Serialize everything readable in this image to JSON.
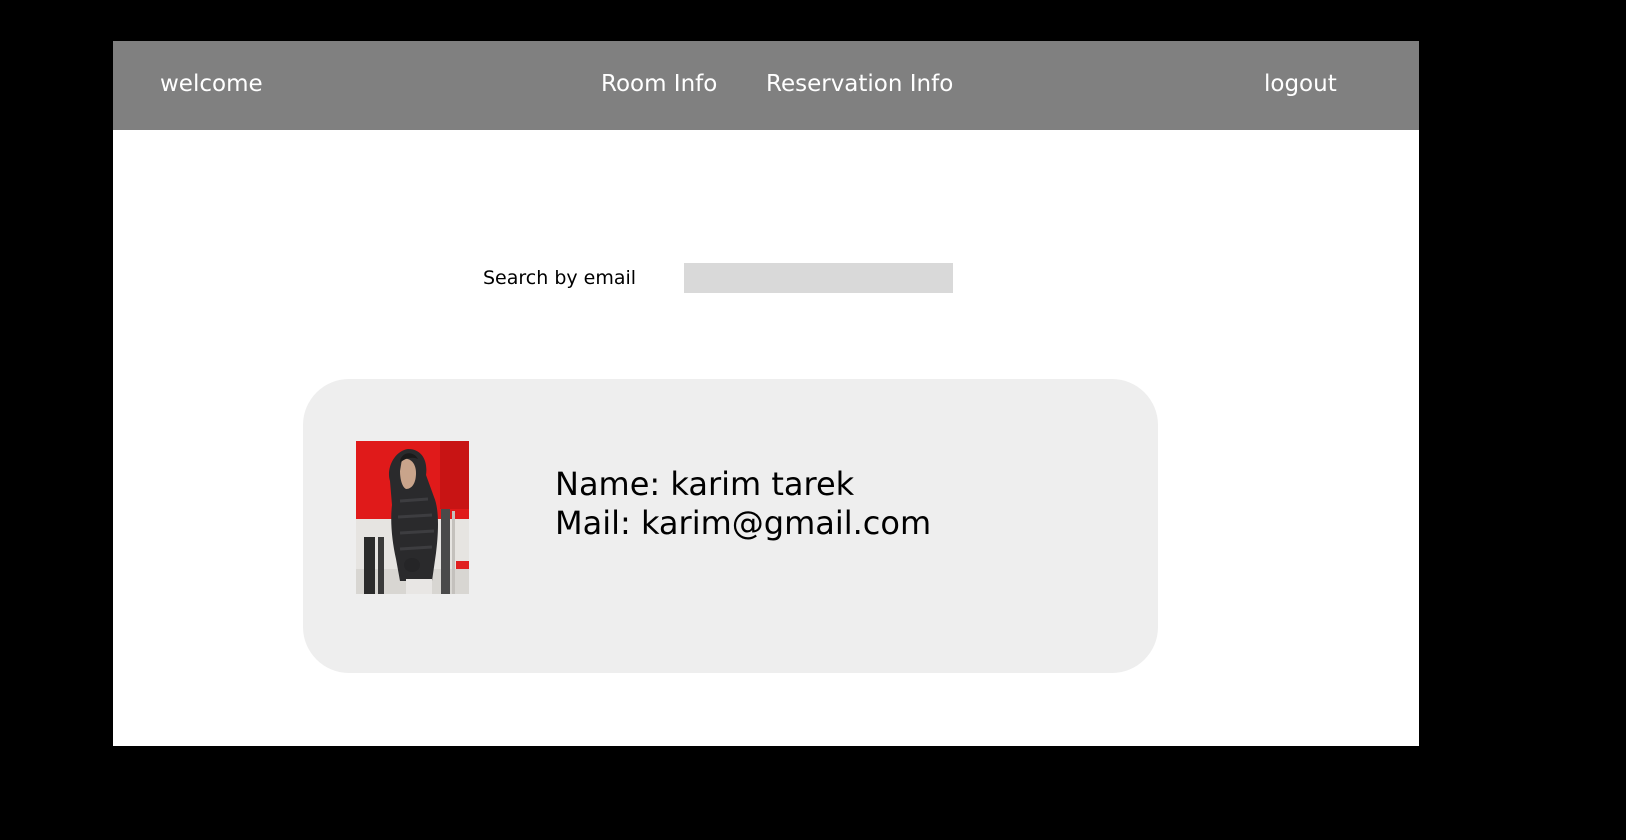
{
  "nav": {
    "welcome": "welcome",
    "room_info": "Room Info",
    "reservation_info": "Reservation Info",
    "logout": "logout"
  },
  "search": {
    "label": "Search by email",
    "value": "",
    "placeholder": ""
  },
  "user": {
    "name_line": "Name: karim tarek",
    "mail_line": "Mail: karim@gmail.com",
    "photo": "user-profile-photo"
  },
  "colors": {
    "navbar": "#808080",
    "nav_text": "#ffffff",
    "page_background": "#ffffff",
    "outer_background": "#000000",
    "search_field": "#d9d9d9",
    "card": "#eeeeee"
  }
}
